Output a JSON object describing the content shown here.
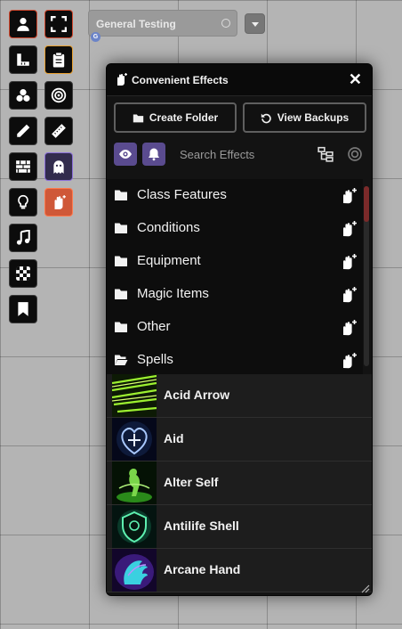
{
  "toolbar": {
    "left": [
      {
        "icon": "user-icon",
        "state": "active"
      },
      {
        "icon": "ruler-icon",
        "state": "normal"
      },
      {
        "icon": "shapes-icon",
        "state": "normal"
      },
      {
        "icon": "pencil-icon",
        "state": "normal"
      },
      {
        "icon": "wall-icon",
        "state": "normal"
      },
      {
        "icon": "lightbulb-icon",
        "state": "normal"
      },
      {
        "icon": "music-icon",
        "state": "normal"
      },
      {
        "icon": "checkerboard-icon",
        "state": "normal"
      },
      {
        "icon": "bookmark-icon",
        "state": "normal"
      }
    ],
    "right": [
      {
        "icon": "expand-icon",
        "state": "active"
      },
      {
        "icon": "clipboard-icon",
        "state": "highlight"
      },
      {
        "icon": "target-icon",
        "state": "normal"
      },
      {
        "icon": "tape-icon",
        "state": "normal"
      },
      {
        "icon": "ghost-icon",
        "state": "selected"
      },
      {
        "icon": "hand-sparkle-icon",
        "state": "orange"
      }
    ]
  },
  "scene": {
    "name": "General Testing",
    "badge": "G"
  },
  "app": {
    "title": "Convenient Effects",
    "close": "✕",
    "create_folder": "Create Folder",
    "view_backups": "View Backups",
    "search_placeholder": "Search Effects"
  },
  "folders": [
    {
      "label": "Class Features",
      "open": false
    },
    {
      "label": "Conditions",
      "open": false
    },
    {
      "label": "Equipment",
      "open": false
    },
    {
      "label": "Magic Items",
      "open": false
    },
    {
      "label": "Other",
      "open": false
    },
    {
      "label": "Spells",
      "open": true
    }
  ],
  "effects": [
    {
      "label": "Acid Arrow",
      "art": "acid-arrow"
    },
    {
      "label": "Aid",
      "art": "aid"
    },
    {
      "label": "Alter Self",
      "art": "alter-self"
    },
    {
      "label": "Antilife Shell",
      "art": "antilife-shell"
    },
    {
      "label": "Arcane Hand",
      "art": "arcane-hand"
    }
  ],
  "colors": {
    "accent_purple": "#5a4b8f",
    "active_border": "#d0462c",
    "orange_button": "#cf5838",
    "panel_bg": "#131313"
  }
}
